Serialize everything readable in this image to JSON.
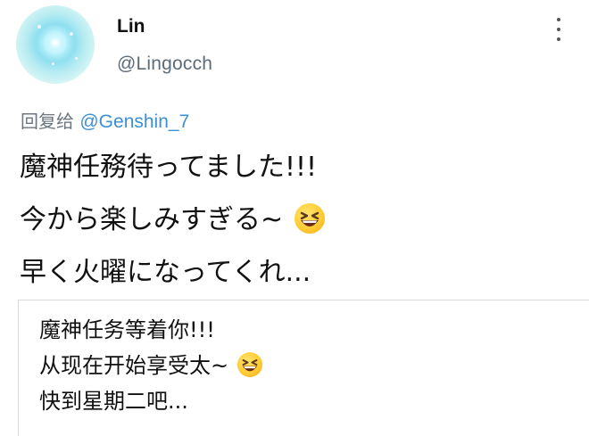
{
  "user": {
    "display_name": "Lin",
    "handle": "@Lingocch"
  },
  "reply": {
    "prefix": "回复给",
    "mention": "@Genshin_7"
  },
  "tweet": {
    "lines": [
      "魔神任務待ってました!!!",
      "今から楽しみすぎる~",
      "早く火曜になってくれ..."
    ],
    "emoji_after_line_index": 1,
    "emoji_name": "grinning-squinting-face-emoji"
  },
  "translation": {
    "lines": [
      "魔神任务等着你!!!",
      "从现在开始享受太~",
      "快到星期二吧..."
    ],
    "emoji_after_line_index": 1,
    "emoji_name": "grinning-squinting-face-emoji"
  },
  "icons": {
    "more": "vertical-ellipsis-icon"
  },
  "colors": {
    "handle": "#5c6b78",
    "mention": "#3d8fd6",
    "divider": "#d9d9d9"
  }
}
